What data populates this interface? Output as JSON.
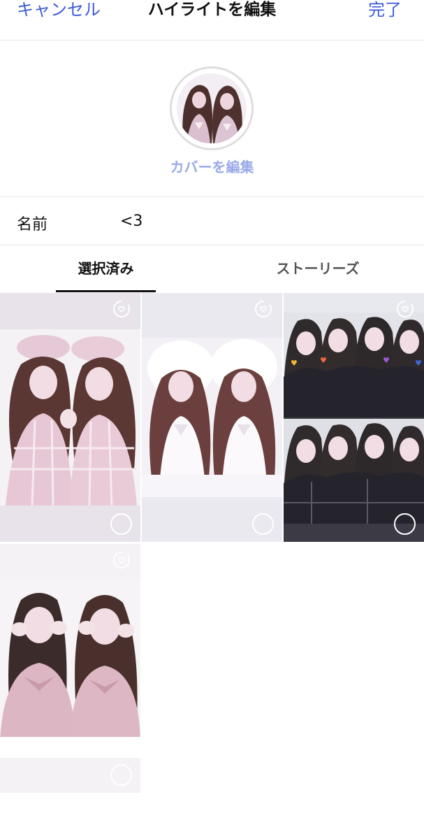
{
  "header": {
    "cancel_label": "キャンセル",
    "title": "ハイライトを編集",
    "done_label": "完了"
  },
  "cover": {
    "edit_label": "カバーを編集"
  },
  "name_field": {
    "label": "名前",
    "value": "<3"
  },
  "tabs": [
    {
      "label": "選択済み",
      "selected": true
    },
    {
      "label": "ストーリーズ",
      "selected": false
    }
  ],
  "stories": [
    {
      "kind": "two-girls-gingham-berets",
      "background": "#e8e2ea",
      "selected": false
    },
    {
      "kind": "two-girls-fur-hoods",
      "background": "#eae9ef",
      "selected": false
    },
    {
      "kind": "four-girls-collage",
      "background": "#3c3a44",
      "selected": false
    },
    {
      "kind": "two-girls-pink-cardigans",
      "background": "#f4f2f5",
      "selected": false
    }
  ],
  "colors": {
    "accent": "#3d5ad8",
    "cover_edit": "#9aaae8",
    "divider": "#e6e6e6",
    "selection_ring": "#ffffff"
  },
  "icons": {
    "story_badge": "boomerang-heart-icon",
    "selection": "selection-circle-icon"
  }
}
